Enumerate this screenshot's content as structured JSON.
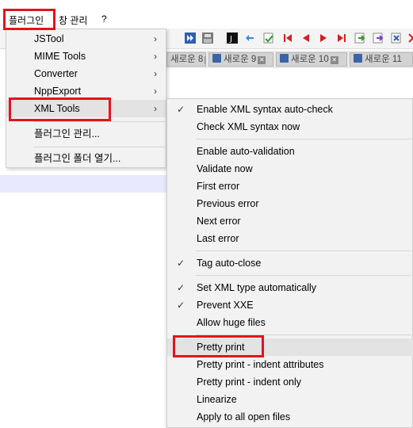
{
  "menubar": {
    "items": [
      {
        "label": "플러그인"
      },
      {
        "label": "창 관리"
      },
      {
        "label": "?"
      }
    ]
  },
  "tabs": [
    {
      "label": "새로운 8"
    },
    {
      "label": "새로운 9"
    },
    {
      "label": "새로운 10"
    },
    {
      "label": "새로운 11"
    }
  ],
  "plugins_menu": {
    "items": [
      {
        "label": "JSTool",
        "submenu": true
      },
      {
        "label": "MIME Tools",
        "submenu": true
      },
      {
        "label": "Converter",
        "submenu": true
      },
      {
        "label": "NppExport",
        "submenu": true
      },
      {
        "label": "XML Tools",
        "submenu": true
      },
      {
        "label": "플러그인 관리...",
        "submenu": false
      },
      {
        "label": "플러그인 폴더 열기...",
        "submenu": false
      }
    ]
  },
  "xml_tools_menu": {
    "items": [
      {
        "label": "Enable XML syntax auto-check",
        "checked": true
      },
      {
        "label": "Check XML syntax now",
        "checked": false
      },
      {
        "label": "Enable auto-validation",
        "checked": false
      },
      {
        "label": "Validate now",
        "checked": false
      },
      {
        "label": "First error",
        "checked": false
      },
      {
        "label": "Previous error",
        "checked": false
      },
      {
        "label": "Next error",
        "checked": false
      },
      {
        "label": "Last error",
        "checked": false
      },
      {
        "label": "Tag auto-close",
        "checked": true
      },
      {
        "label": "Set XML type automatically",
        "checked": true
      },
      {
        "label": "Prevent XXE",
        "checked": true
      },
      {
        "label": "Allow huge files",
        "checked": false
      },
      {
        "label": "Pretty print",
        "checked": false
      },
      {
        "label": "Pretty print - indent attributes",
        "checked": false
      },
      {
        "label": "Pretty print - indent only",
        "checked": false
      },
      {
        "label": "Linearize",
        "checked": false
      },
      {
        "label": "Apply to all open files",
        "checked": false
      }
    ]
  },
  "symbols": {
    "check": "✓",
    "submenu_arrow": "›",
    "tab_close": "✕"
  },
  "colors": {
    "highlight_red": "#e2141b",
    "menu_bg": "#f2f2f2",
    "hover_bg": "#e3e3e3"
  }
}
